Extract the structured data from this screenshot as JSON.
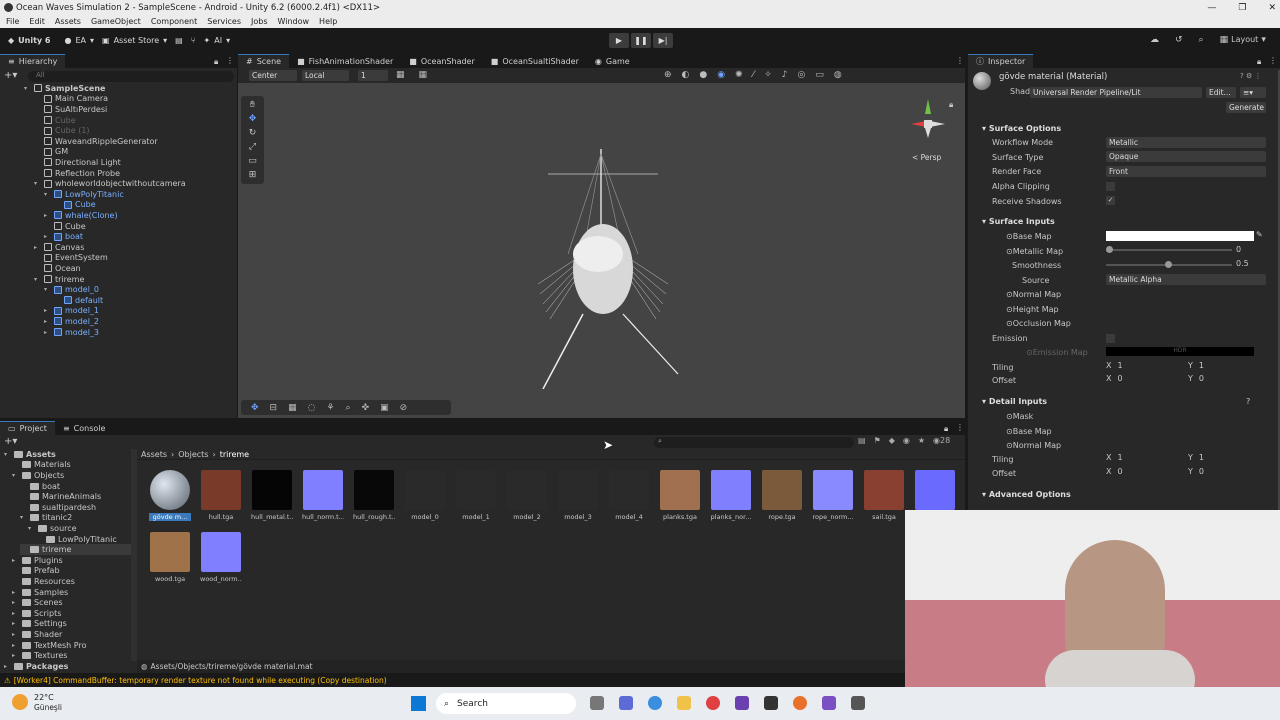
{
  "window": {
    "title": "Ocean Waves Simulation 2 - SampleScene - Android - Unity 6.2 (6000.2.4f1) <DX11>",
    "minimize": "—",
    "maximize": "❐",
    "close": "✕"
  },
  "menu": [
    "File",
    "Edit",
    "Assets",
    "GameObject",
    "Component",
    "Services",
    "Jobs",
    "Window",
    "Help"
  ],
  "toolbar": {
    "unity_label": "Unity 6",
    "account": "EA",
    "asset_store": "Asset Store",
    "ai": "AI",
    "layout": "Layout"
  },
  "hierarchy": {
    "title": "Hierarchy",
    "search_placeholder": "All",
    "scene": "SampleScene",
    "items": [
      {
        "label": "Main Camera"
      },
      {
        "label": "SuAltıPerdesi"
      },
      {
        "label": "Cube"
      },
      {
        "label": "Cube (1)"
      },
      {
        "label": "WaveandRippleGenerator"
      },
      {
        "label": "GM"
      },
      {
        "label": "Directional Light"
      },
      {
        "label": "Reflection Probe"
      },
      {
        "label": "wholeworldobjectwithoutcamera"
      },
      {
        "label": "LowPolyTitanic"
      },
      {
        "label": "Cube"
      },
      {
        "label": "whale(Clone)"
      },
      {
        "label": "Cube"
      },
      {
        "label": "boat"
      },
      {
        "label": "Canvas"
      },
      {
        "label": "EventSystem"
      },
      {
        "label": "Ocean"
      },
      {
        "label": "trireme"
      },
      {
        "label": "model_0"
      },
      {
        "label": "default"
      },
      {
        "label": "model_1"
      },
      {
        "label": "model_2"
      },
      {
        "label": "model_3"
      }
    ]
  },
  "scene_tabs": [
    "Scene",
    "FishAnimationShader",
    "OceanShader",
    "OceanSualtiShader",
    "Game"
  ],
  "scene_toolbar": {
    "pivot": "Center",
    "space": "Local",
    "grid": "1",
    "persp": "Persp"
  },
  "inspector": {
    "title": "Inspector",
    "material_name": "gövde material (Material)",
    "shader_label": "Shader",
    "shader_value": "Universal Render Pipeline/Lit",
    "edit_btn": "Edit...",
    "generate_btn": "Generate",
    "surface_options": "Surface Options",
    "workflow_mode": "Workflow Mode",
    "workflow_value": "Metallic",
    "surface_type": "Surface Type",
    "surface_value": "Opaque",
    "render_face": "Render Face",
    "render_face_value": "Front",
    "alpha_clipping": "Alpha Clipping",
    "receive_shadows": "Receive Shadows",
    "surface_inputs": "Surface Inputs",
    "base_map": "Base Map",
    "metallic_map": "Metallic Map",
    "metallic_value": "0",
    "smoothness": "Smoothness",
    "smoothness_value": "0.5",
    "source": "Source",
    "source_value": "Metallic Alpha",
    "normal_map": "Normal Map",
    "height_map": "Height Map",
    "occlusion_map": "Occlusion Map",
    "emission": "Emission",
    "emission_map": "Emission Map",
    "emission_hdr": "HDR",
    "tiling": "Tiling",
    "offset": "Offset",
    "x": "X",
    "y": "Y",
    "tiling_x": "1",
    "tiling_y": "1",
    "offset_x": "0",
    "offset_y": "0",
    "detail_inputs": "Detail Inputs",
    "mask": "Mask",
    "detail_base_map": "Base Map",
    "detail_normal_map": "Normal Map",
    "detail_tiling_x": "1",
    "detail_tiling_y": "1",
    "detail_offset_x": "0",
    "detail_offset_y": "0",
    "advanced_options": "Advanced Options"
  },
  "project": {
    "tab_project": "Project",
    "tab_console": "Console",
    "breadcrumb": [
      "Assets",
      "Objects",
      "trireme"
    ],
    "count": "28",
    "tree": [
      {
        "label": "Assets"
      },
      {
        "label": "Materials"
      },
      {
        "label": "Objects"
      },
      {
        "label": "boat"
      },
      {
        "label": "MarineAnimals"
      },
      {
        "label": "sualtipardesh"
      },
      {
        "label": "titanic2"
      },
      {
        "label": "source"
      },
      {
        "label": "LowPolyTitanic"
      },
      {
        "label": "trireme"
      },
      {
        "label": "Plugins"
      },
      {
        "label": "Prefab"
      },
      {
        "label": "Resources"
      },
      {
        "label": "Samples"
      },
      {
        "label": "Scenes"
      },
      {
        "label": "Scripts"
      },
      {
        "label": "Settings"
      },
      {
        "label": "Shader"
      },
      {
        "label": "TextMesh Pro"
      },
      {
        "label": "Textures"
      },
      {
        "label": "Packages"
      }
    ],
    "assets": [
      {
        "label": "gövde m...",
        "color": "#8f9aa6"
      },
      {
        "label": "hull.tga",
        "color": "#7a3a2a"
      },
      {
        "label": "hull_metal.t...",
        "color": "#050505"
      },
      {
        "label": "hull_norm.t...",
        "color": "#7f7fff"
      },
      {
        "label": "hull_rough.t...",
        "color": "#080808"
      },
      {
        "label": "model_0",
        "color": "#2a2a2a"
      },
      {
        "label": "model_1",
        "color": "#2a2a2a"
      },
      {
        "label": "model_2",
        "color": "#2a2a2a"
      },
      {
        "label": "model_3",
        "color": "#2a2a2a"
      },
      {
        "label": "model_4",
        "color": "#2a2a2a"
      },
      {
        "label": "planks.tga",
        "color": "#a07050"
      },
      {
        "label": "planks_nor...",
        "color": "#8080ff"
      },
      {
        "label": "rope.tga",
        "color": "#7a5a3a"
      },
      {
        "label": "rope_norm...",
        "color": "#8a8aff"
      },
      {
        "label": "sail.tga",
        "color": "#8a4030"
      },
      {
        "label": "",
        "color": "#6a6aff"
      },
      {
        "label": "wood.tga",
        "color": "#a0724a"
      },
      {
        "label": "wood_norm...",
        "color": "#7f7fff"
      }
    ],
    "status_path": "Assets/Objects/trireme/gövde material.mat"
  },
  "status_bar": {
    "message": "[Worker4] CommandBuffer: temporary render texture  not found while executing  (Copy destination)"
  },
  "taskbar": {
    "temp": "22°C",
    "weather": "Güneşli",
    "search": "Search"
  },
  "colors": {
    "accent": "#3a79bb",
    "warning": "#ffc107",
    "prefab_blue": "#7ab0ff"
  }
}
